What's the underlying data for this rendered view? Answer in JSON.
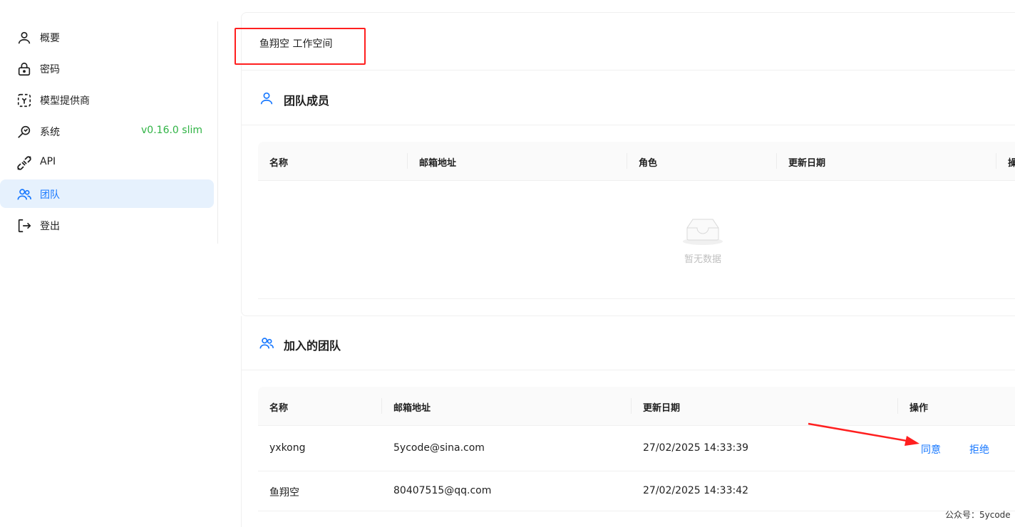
{
  "sidebar": {
    "items": [
      {
        "label": "概要",
        "icon": "user-icon"
      },
      {
        "label": "密码",
        "icon": "lock-icon"
      },
      {
        "label": "模型提供商",
        "icon": "model-provider-icon"
      },
      {
        "label": "系统",
        "icon": "system-icon",
        "badge": "v0.16.0 slim"
      },
      {
        "label": "API",
        "icon": "plug-icon"
      },
      {
        "label": "团队",
        "icon": "team-icon",
        "active": true
      },
      {
        "label": "登出",
        "icon": "logout-icon"
      }
    ]
  },
  "workspace": {
    "title": "鱼翔空 工作空间"
  },
  "team_members": {
    "title": "团队成员",
    "columns": [
      "名称",
      "邮箱地址",
      "角色",
      "更新日期",
      "操"
    ],
    "empty_text": "暂无数据"
  },
  "joined_teams": {
    "title": "加入的团队",
    "columns": [
      "名称",
      "邮箱地址",
      "更新日期",
      "操作"
    ],
    "rows": [
      {
        "name": "yxkong",
        "email": "5ycode@sina.com",
        "updated": "27/02/2025 14:33:39",
        "agree": "同意",
        "reject": "拒绝"
      },
      {
        "name": "鱼翔空",
        "email": "80407515@qq.com",
        "updated": "27/02/2025 14:33:42"
      }
    ]
  },
  "watermark": "公众号：5ycode",
  "colors": {
    "accent": "#1677ff",
    "badge": "#2fb344",
    "annotation": "#ff1f1f"
  }
}
